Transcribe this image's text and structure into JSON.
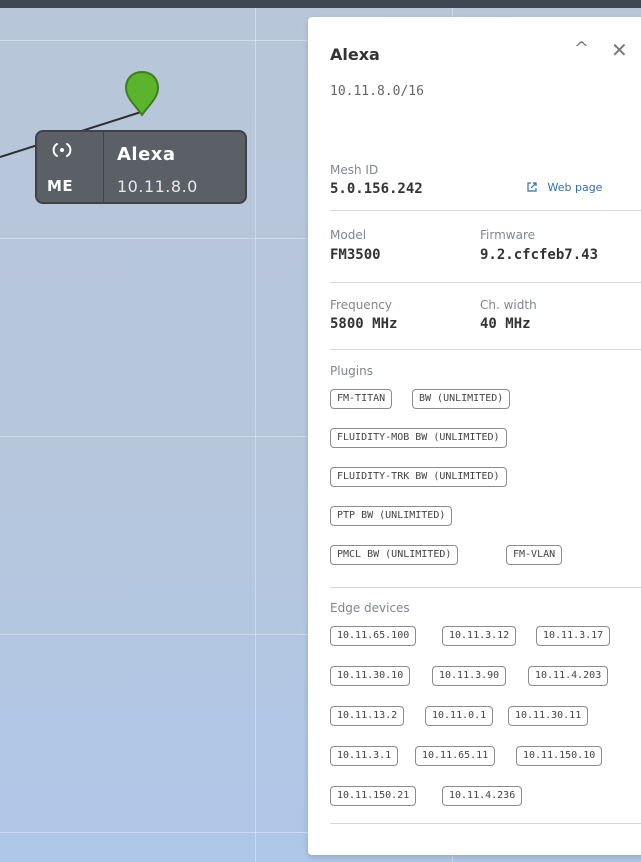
{
  "device": {
    "name": "Alexa",
    "subnet": "10.11.8.0/16",
    "node_role": "ME",
    "node_ip": "10.11.8.0"
  },
  "panel": {
    "mesh_label": "Mesh ID",
    "mesh_value": "5.0.156.242",
    "web_page_label": "Web page",
    "model_label": "Model",
    "model_value": "FM3500",
    "firmware_label": "Firmware",
    "firmware_value": "9.2.cfcfeb7.43",
    "frequency_label": "Frequency",
    "frequency_value": "5800 MHz",
    "chwidth_label": "Ch. width",
    "chwidth_value": "40 MHz",
    "plugins_label": "Plugins",
    "plugins": [
      "FM-TITAN",
      "BW (UNLIMITED)",
      "FLUIDITY-MOB BW (UNLIMITED)",
      "FLUIDITY-TRK BW (UNLIMITED)",
      "PTP BW (UNLIMITED)",
      "PMCL BW (UNLIMITED)",
      "FM-VLAN"
    ],
    "edge_label": "Edge devices",
    "edge_devices": [
      "10.11.65.100",
      "10.11.3.12",
      "10.11.3.17",
      "10.11.30.10",
      "10.11.3.90",
      "10.11.4.203",
      "10.11.13.2",
      "10.11.0.1",
      "10.11.30.11",
      "10.11.3.1",
      "10.11.65.11",
      "10.11.150.10",
      "10.11.150.21",
      "10.11.4.236"
    ]
  },
  "colors": {
    "map_background": "#b8c6d9",
    "node_card": "#5b5f66",
    "pin_green": "#5bb42b",
    "link_text": "#2f6db1"
  },
  "icons": {
    "collapse": "chevron-up-icon",
    "close": "close-icon",
    "external": "external-link-icon",
    "radio": "radio-icon",
    "pin": "map-pin-icon"
  }
}
